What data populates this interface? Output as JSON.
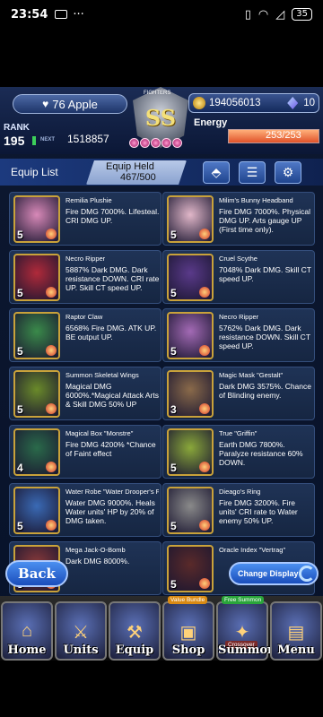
{
  "status_bar": {
    "time": "23:54",
    "battery": "35"
  },
  "header": {
    "player_name": "76 Apple",
    "rank_label": "RANK",
    "rank": "195",
    "next_label": "NEXT",
    "next_exp": "1518857",
    "emblem_label": "FIGHTERS",
    "emblem_grade": "SS",
    "gems": "194056013",
    "crystals": "10",
    "energy_label": "Energy",
    "energy": "253/253",
    "energy_fraction": 1.0
  },
  "equip_bar": {
    "title": "Equip List",
    "held_label": "Equip Held",
    "held_value": "467/500",
    "icons": [
      "tag-icon",
      "sort-icon",
      "gear-icon"
    ]
  },
  "items": [
    {
      "name": "Remilia Plushie",
      "desc": "Fire DMG 7000%. Lifesteal. CRI DMG UP.",
      "level": "5"
    },
    {
      "name": "Milim's Bunny Headband",
      "desc": "Fire DMG 7000%. Physical DMG UP. Arts gauge UP (First time only).",
      "level": "5"
    },
    {
      "name": "Necro Ripper",
      "desc": "5887% Dark DMG. Dark resistance DOWN. CRI rate UP. Skill CT speed UP.",
      "level": "5"
    },
    {
      "name": "Cruel Scythe",
      "desc": "7048% Dark DMG. Skill CT speed UP.",
      "level": "5"
    },
    {
      "name": "Raptor Claw",
      "desc": "6568% Fire DMG. ATK UP. BE output UP.",
      "level": "5"
    },
    {
      "name": "Necro Ripper",
      "desc": "5762% Dark DMG. Dark resistance DOWN. Skill CT speed UP.",
      "level": "5"
    },
    {
      "name": "Summon Skeletal Wings",
      "desc": "Magical DMG 6000%.*Magical Attack Arts & Skill DMG 50% UP",
      "level": "5"
    },
    {
      "name": "Magic Mask \"Gestalt\"",
      "desc": "Dark DMG 3575%. Chance of Blinding enemy.",
      "level": "3"
    },
    {
      "name": "Magical Box \"Monstre\"",
      "desc": "Fire DMG 4200% *Chance of Faint effect",
      "level": "4"
    },
    {
      "name": "True \"Griffin\"",
      "desc": "Earth DMG 7800%. Paralyze resistance 60% DOWN.",
      "level": "5"
    },
    {
      "name": "Water Robe \"Water Drooper's Fairy Earrings\"",
      "desc": "Water DMG 9000%. Heals Water units' HP by 20% of DMG taken.",
      "level": "5"
    },
    {
      "name": "Dieago's Ring",
      "desc": "Fire DMG 3200%. Fire units' CRI rate to Water enemy 50% UP.",
      "level": "5"
    },
    {
      "name": "Mega Jack-O-Bomb",
      "desc": "Dark DMG 8000%.",
      "level": "5"
    },
    {
      "name": "Oracle Index \"Vertrag\"",
      "desc": "",
      "level": "5"
    }
  ],
  "buttons": {
    "back": "Back",
    "change_display": "Change Display"
  },
  "nav": [
    {
      "label": "Home",
      "badge": ""
    },
    {
      "label": "Units",
      "badge": ""
    },
    {
      "label": "Equip",
      "badge": ""
    },
    {
      "label": "Shop",
      "badge": "Value Bundle"
    },
    {
      "label": "Summon",
      "badge": "Free Summon",
      "tag": "Crossover"
    },
    {
      "label": "Menu",
      "badge": ""
    }
  ]
}
